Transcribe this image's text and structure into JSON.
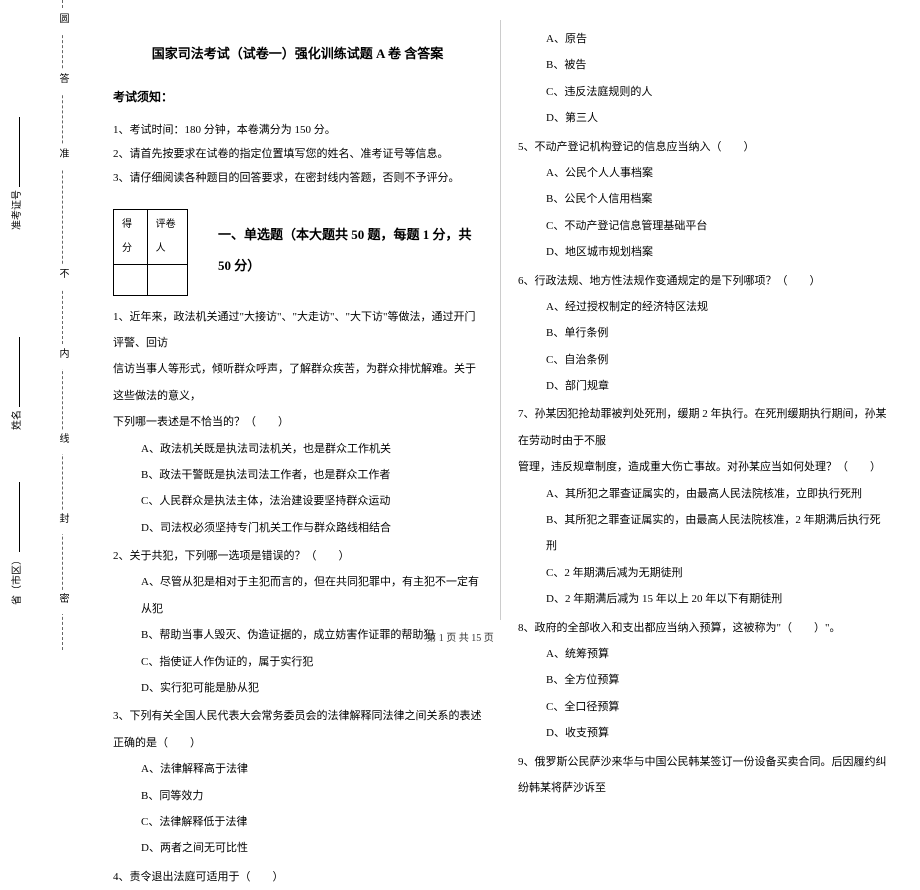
{
  "binding": {
    "top_char": "圆",
    "seal1": "密",
    "seal2": "封",
    "seal3": "线",
    "seal4": "内",
    "seal5": "不",
    "seal6": "准",
    "seal7": "答"
  },
  "side_fields": {
    "province": "省（市区）",
    "name": "姓名",
    "ticket": "准考证号"
  },
  "header": {
    "title": "国家司法考试（试卷一）强化训练试题 A 卷 含答案",
    "notice_heading": "考试须知：",
    "notice1": "1、考试时间：180 分钟，本卷满分为 150 分。",
    "notice2": "2、请首先按要求在试卷的指定位置填写您的姓名、准考证号等信息。",
    "notice3": "3、请仔细阅读各种题目的回答要求，在密封线内答题，否则不予评分。"
  },
  "scorebox": {
    "score": "得分",
    "marker": "评卷人"
  },
  "section1": {
    "title": "一、单选题（本大题共 50 题，每题 1 分，共 50 分）"
  },
  "q1": {
    "stem1": "1、近年来，政法机关通过\"大接访\"、\"大走访\"、\"大下访\"等做法，通过开门评警、回访",
    "stem2": "信访当事人等形式，倾听群众呼声，了解群众疾苦，为群众排忧解难。关于这些做法的意义，",
    "stem3": "下列哪一表述是不恰当的？（　　）",
    "a": "A、政法机关既是执法司法机关，也是群众工作机关",
    "b": "B、政法干警既是执法司法工作者，也是群众工作者",
    "c": "C、人民群众是执法主体，法治建设要坚持群众运动",
    "d": "D、司法权必须坚持专门机关工作与群众路线相结合"
  },
  "q2": {
    "stem": "2、关于共犯，下列哪一选项是错误的？（　　）",
    "a": "A、尽管从犯是相对于主犯而言的，但在共同犯罪中，有主犯不一定有从犯",
    "b": "B、帮助当事人毁灭、伪造证据的，成立妨害作证罪的帮助犯",
    "c": "C、指使证人作伪证的，属于实行犯",
    "d": "D、实行犯可能是胁从犯"
  },
  "q3": {
    "stem": "3、下列有关全国人民代表大会常务委员会的法律解释同法律之间关系的表述正确的是（　　）",
    "a": "A、法律解释高于法律",
    "b": "B、同等效力",
    "c": "C、法律解释低于法律",
    "d": "D、两者之间无可比性"
  },
  "q4": {
    "stem": "4、责令退出法庭可适用于（　　）"
  },
  "q4opts": {
    "a": "A、原告",
    "b": "B、被告",
    "c": "C、违反法庭规则的人",
    "d": "D、第三人"
  },
  "q5": {
    "stem": "5、不动产登记机构登记的信息应当纳入（　　）",
    "a": "A、公民个人人事档案",
    "b": "B、公民个人信用档案",
    "c": "C、不动产登记信息管理基础平台",
    "d": "D、地区城市规划档案"
  },
  "q6": {
    "stem": "6、行政法规、地方性法规作变通规定的是下列哪项？（　　）",
    "a": "A、经过授权制定的经济特区法规",
    "b": "B、单行条例",
    "c": "C、自治条例",
    "d": "D、部门规章"
  },
  "q7": {
    "stem1": "7、孙某因犯抢劫罪被判处死刑，缓期 2 年执行。在死刑缓期执行期间，孙某在劳动时由于不服",
    "stem2": "管理，违反规章制度，造成重大伤亡事故。对孙某应当如何处理？（　　）",
    "a": "A、其所犯之罪查证属实的，由最高人民法院核准，立即执行死刑",
    "b": "B、其所犯之罪查证属实的，由最高人民法院核准，2 年期满后执行死刑",
    "c": "C、2 年期满后减为无期徒刑",
    "d": "D、2 年期满后减为 15 年以上 20 年以下有期徒刑"
  },
  "q8": {
    "stem": "8、政府的全部收入和支出都应当纳入预算，这被称为\"（　　）\"。",
    "a": "A、统筹预算",
    "b": "B、全方位预算",
    "c": "C、全口径预算",
    "d": "D、收支预算"
  },
  "q9": {
    "stem": "9、俄罗斯公民萨沙来华与中国公民韩某签订一份设备买卖合同。后因履约纠纷韩某将萨沙诉至"
  },
  "footer": {
    "text": "第 1 页 共 15 页"
  }
}
